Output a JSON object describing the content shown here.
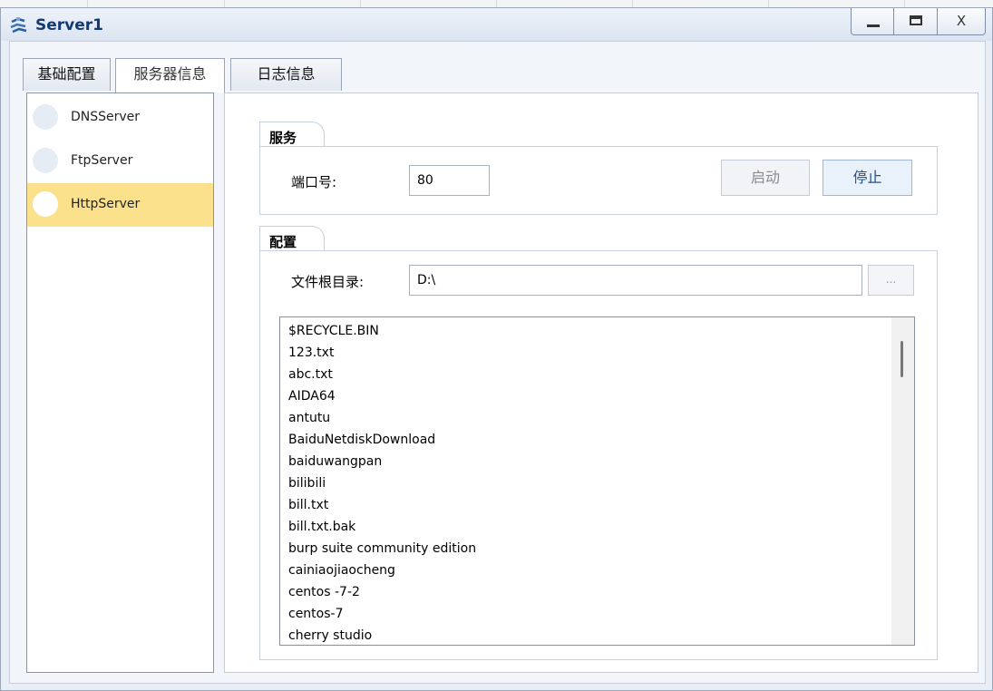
{
  "window": {
    "title": "Server1",
    "close_label": "X"
  },
  "tabs": [
    {
      "label": "基础配置"
    },
    {
      "label": "服务器信息"
    },
    {
      "label": "日志信息"
    }
  ],
  "sidebar": {
    "items": [
      {
        "label": "DNSServer"
      },
      {
        "label": "FtpServer"
      },
      {
        "label": "HttpServer"
      }
    ],
    "selected": "HttpServer"
  },
  "service": {
    "group_label": "服务",
    "port_label": "端口号:",
    "port_value": "80",
    "start_label": "启动",
    "stop_label": "停止"
  },
  "config": {
    "group_label": "配置",
    "root_label": "文件根目录:",
    "root_value": "D:\\",
    "browse_label": "...",
    "files": [
      "$RECYCLE.BIN",
      "123.txt",
      "abc.txt",
      "AIDA64",
      "antutu",
      "BaiduNetdiskDownload",
      "baiduwangpan",
      "bilibili",
      "bill.txt",
      "bill.txt.bak",
      "burp suite community edition",
      "cainiaojiaocheng",
      "centos -7-2",
      "centos-7",
      "cherry studio"
    ]
  },
  "colors": {
    "selected_item": "#fbe18c",
    "title_text": "#143a73",
    "stop_text": "#1f4f8f"
  }
}
